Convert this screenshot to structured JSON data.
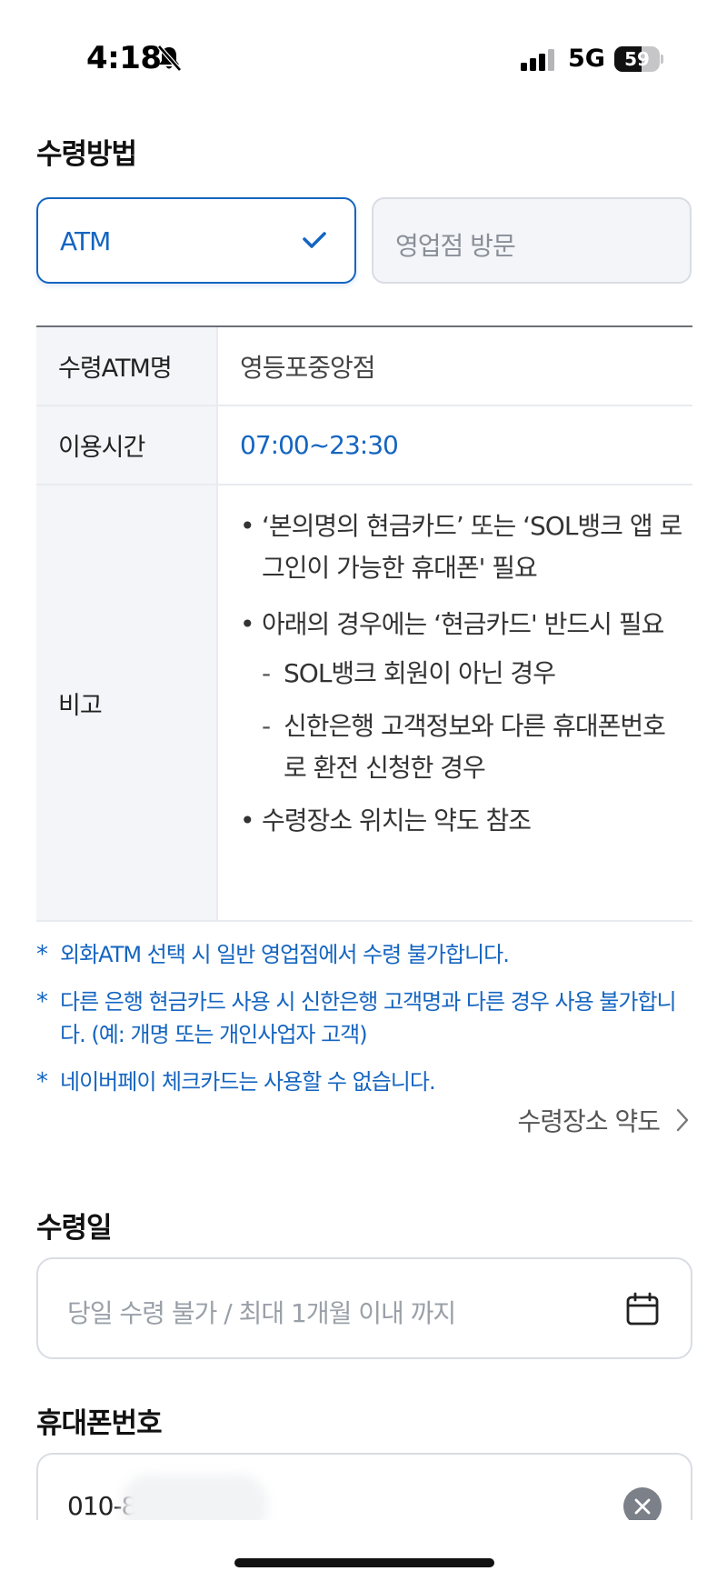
{
  "status_bar": {
    "time": "4:18",
    "network": "5G",
    "battery_percent": 59,
    "battery_label": "59"
  },
  "method": {
    "title": "수령방법",
    "options": [
      {
        "label": "ATM",
        "selected": true
      },
      {
        "label": "영업점 방문",
        "selected": false
      }
    ]
  },
  "info_table": {
    "atm_name_label": "수령ATM명",
    "atm_name_value": "영등포중앙점",
    "hours_label": "이용시간",
    "hours_value": "07:00~23:30",
    "notes_label": "비고",
    "notes": {
      "bullet1": "‘본의명의 현금카드’ 또는 ‘SOL뱅크 앱 로그인이 가능한 휴대폰' 필요",
      "bullet2": "아래의 경우에는 ‘현금카드' 반드시 필요",
      "sub1": "SOL뱅크 회원이 아닌 경우",
      "sub2": "신한은행 고객정보와 다른 휴대폰번호로 환전 신청한 경우",
      "bullet3": "수령장소 위치는 약도 참조"
    }
  },
  "notices": [
    "외화ATM 선택 시 일반 영업점에서 수령 불가합니다.",
    "다른 은행 현금카드 사용 시 신한은행 고객명과 다른 경우 사용 불가합니다. (예: 개명 또는 개인사업자 고객)",
    "네이버페이 체크카드는 사용할 수 없습니다."
  ],
  "map_link": "수령장소 약도",
  "receipt_date": {
    "title": "수령일",
    "placeholder": "당일 수령 불가 / 최대 1개월 이내 까지"
  },
  "phone": {
    "title": "휴대폰번호",
    "value": "010-8"
  },
  "colors": {
    "accent": "#1565c0",
    "border": "#d9dde3",
    "table_head_bg": "#f3f5f8"
  }
}
